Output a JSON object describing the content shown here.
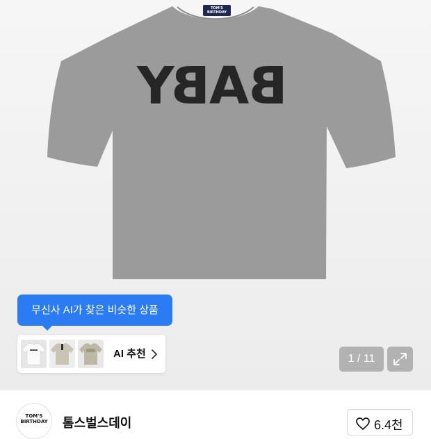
{
  "product": {
    "print_text": "BABY",
    "collar_tag_line1": "TOM'S",
    "collar_tag_line2": "BIRTHDAY"
  },
  "ai_recommend": {
    "tooltip": "무신사 AI가 찾은 비슷한 상품",
    "label": "AI 추천",
    "thumbnails": [
      "white-tee",
      "beige-henley-tee",
      "beige-tee"
    ]
  },
  "gallery": {
    "pager": "1 / 11",
    "expand_icon": "expand-icon"
  },
  "brand": {
    "name": "톰스벌스데이",
    "logo_line1": "TOM'S",
    "logo_line2": "BIRTHDAY"
  },
  "like": {
    "count": "6.4천",
    "icon": "heart-outline-icon"
  },
  "colors": {
    "accent": "#2b7bf3",
    "shirt": "#9b9b9b",
    "print": "#262626",
    "tag": "#1f2850"
  }
}
